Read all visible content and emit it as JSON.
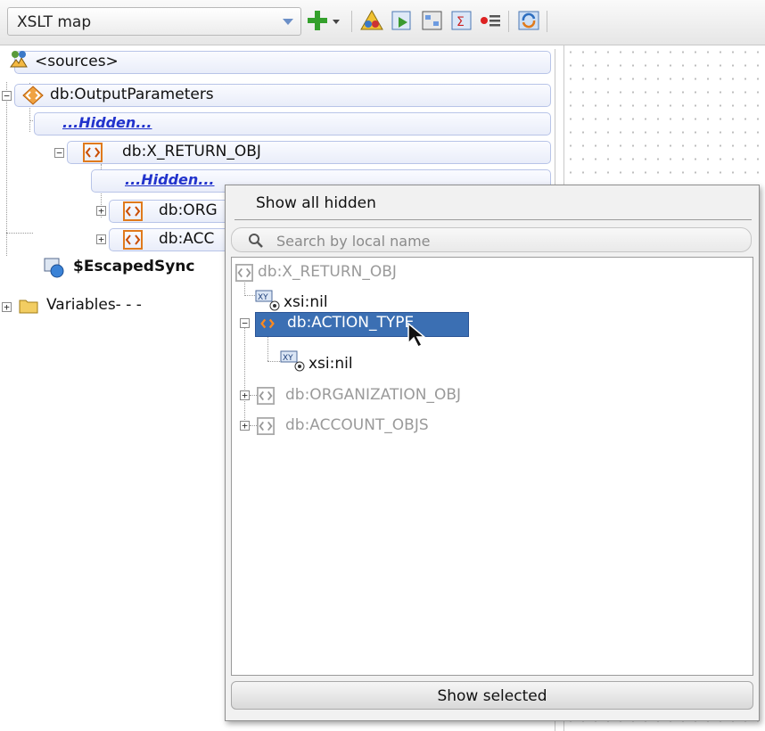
{
  "toolbar": {
    "view_select": "XSLT map",
    "icons": [
      "add-icon",
      "dropdown-icon",
      "warning-icon",
      "test-icon",
      "map-icon",
      "function-icon",
      "list-icon",
      "refresh-icon"
    ]
  },
  "tree": {
    "sources": "<sources>",
    "output_params": "db:OutputParameters",
    "hidden1": "...Hidden...",
    "return_obj": "db:X_RETURN_OBJ",
    "hidden2": "...Hidden...",
    "org_obj": "db:ORG",
    "acc_obj": "db:ACC",
    "escaped": "$EscapedSync",
    "variables": "Variables- - -"
  },
  "popup": {
    "title": "Show all hidden",
    "search_placeholder": "Search by local name",
    "items": {
      "return_obj": "db:X_RETURN_OBJ",
      "xsi_nil_1": "xsi:nil",
      "action_type": "db:ACTION_TYPE",
      "xsi_nil_2": "xsi:nil",
      "org_obj": "db:ORGANIZATION_OBJ",
      "accounts": "db:ACCOUNT_OBJS"
    },
    "show_selected": "Show selected"
  },
  "colors": {
    "selection": "#3b6fb3",
    "link": "#2233cc",
    "accent": "#e07a1c"
  }
}
